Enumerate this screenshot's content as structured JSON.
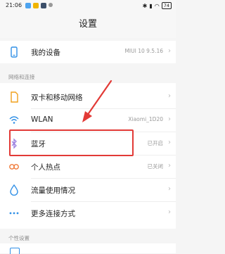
{
  "status_bar": {
    "time": "21:06",
    "battery": "74"
  },
  "header": {
    "title": "设置"
  },
  "device": {
    "label": "我的设备",
    "value": "MIUI 10 9.5.16"
  },
  "network_section": {
    "label": "网络和连接"
  },
  "network_items": [
    {
      "label": "双卡和移动网络",
      "value": "",
      "icon": "sim-card-icon"
    },
    {
      "label": "WLAN",
      "value": "Xiaomi_1D20",
      "icon": "wifi-icon"
    },
    {
      "label": "蓝牙",
      "value": "已开启",
      "icon": "bluetooth-icon"
    },
    {
      "label": "个人热点",
      "value": "已关闭",
      "icon": "hotspot-icon"
    },
    {
      "label": "流量使用情况",
      "value": "",
      "icon": "data-usage-icon"
    },
    {
      "label": "更多连接方式",
      "value": "",
      "icon": "more-connections-icon"
    }
  ],
  "personal_section": {
    "label": "个性设置"
  },
  "colors": {
    "accent": "#2f8fe6",
    "highlight": "#e23a36"
  }
}
